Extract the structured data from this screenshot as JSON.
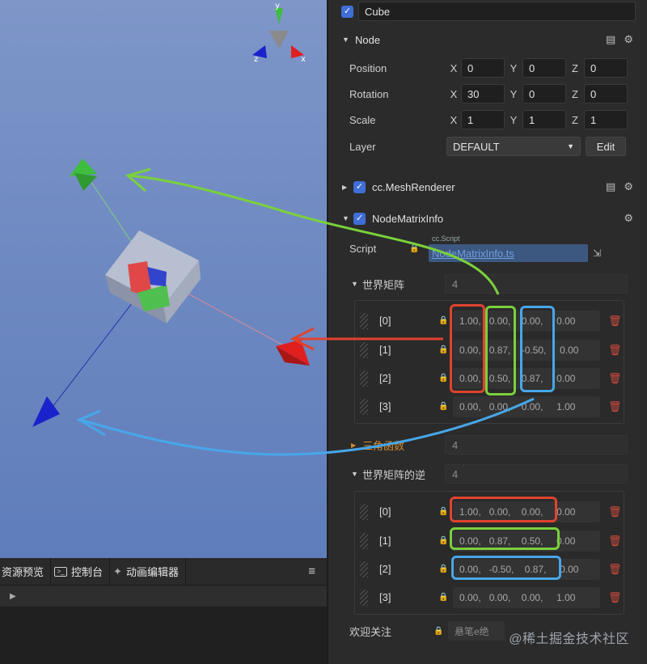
{
  "node": {
    "name": "Cube"
  },
  "node_section": {
    "title": "Node",
    "position": {
      "label": "Position",
      "x": "0",
      "y": "0",
      "z": "0"
    },
    "rotation": {
      "label": "Rotation",
      "x": "30",
      "y": "0",
      "z": "0"
    },
    "scale": {
      "label": "Scale",
      "x": "1",
      "y": "1",
      "z": "1"
    },
    "layer": {
      "label": "Layer",
      "value": "DEFAULT",
      "edit": "Edit"
    },
    "axes": {
      "x": "X",
      "y": "Y",
      "z": "Z"
    }
  },
  "mesh_renderer": {
    "title": "cc.MeshRenderer"
  },
  "matrix_info": {
    "title": "NodeMatrixInfo",
    "script_label": "Script",
    "script_tag": "cc.Script",
    "script_value": "NodeMatrixInfo.ts",
    "world_matrix": {
      "label": "世界矩阵",
      "count": "4",
      "rows": [
        {
          "index": "[0]",
          "values": "1.00,   0.00,    0.00,     0.00"
        },
        {
          "index": "[1]",
          "values": "0.00,   0.87,    -0.50,     0.00"
        },
        {
          "index": "[2]",
          "values": "0.00,   0.50,    0.87,     0.00"
        },
        {
          "index": "[3]",
          "values": "0.00,   0.00,    0.00,     1.00"
        }
      ]
    },
    "trig": {
      "label": "三角函数",
      "count": "4"
    },
    "inverse_matrix": {
      "label": "世界矩阵的逆",
      "count": "4",
      "rows": [
        {
          "index": "[0]",
          "values": "1.00,   0.00,    0.00,     0.00"
        },
        {
          "index": "[1]",
          "values": "0.00,   0.87,    0.50,     0.00"
        },
        {
          "index": "[2]",
          "values": "0.00,   -0.50,    0.87,     0.00"
        },
        {
          "index": "[3]",
          "values": "0.00,   0.00,    0.00,     1.00"
        }
      ]
    },
    "follow_label": "欢迎关注",
    "follow_value": "悬笔e绝"
  },
  "bottom_tabs": [
    "资源预览",
    "控制台",
    "动画编辑器"
  ],
  "watermark": "@稀土掘金技术社区",
  "colors": {
    "accent": "#3f6ed8",
    "highlight_red": "#e0432f",
    "highlight_green": "#7ad13b",
    "highlight_blue": "#47a7e9"
  },
  "icons": [
    "checkbox-icon",
    "book-icon",
    "gear-icon",
    "lock-icon",
    "trash-icon",
    "menu-icon",
    "console-icon",
    "animation-icon"
  ]
}
